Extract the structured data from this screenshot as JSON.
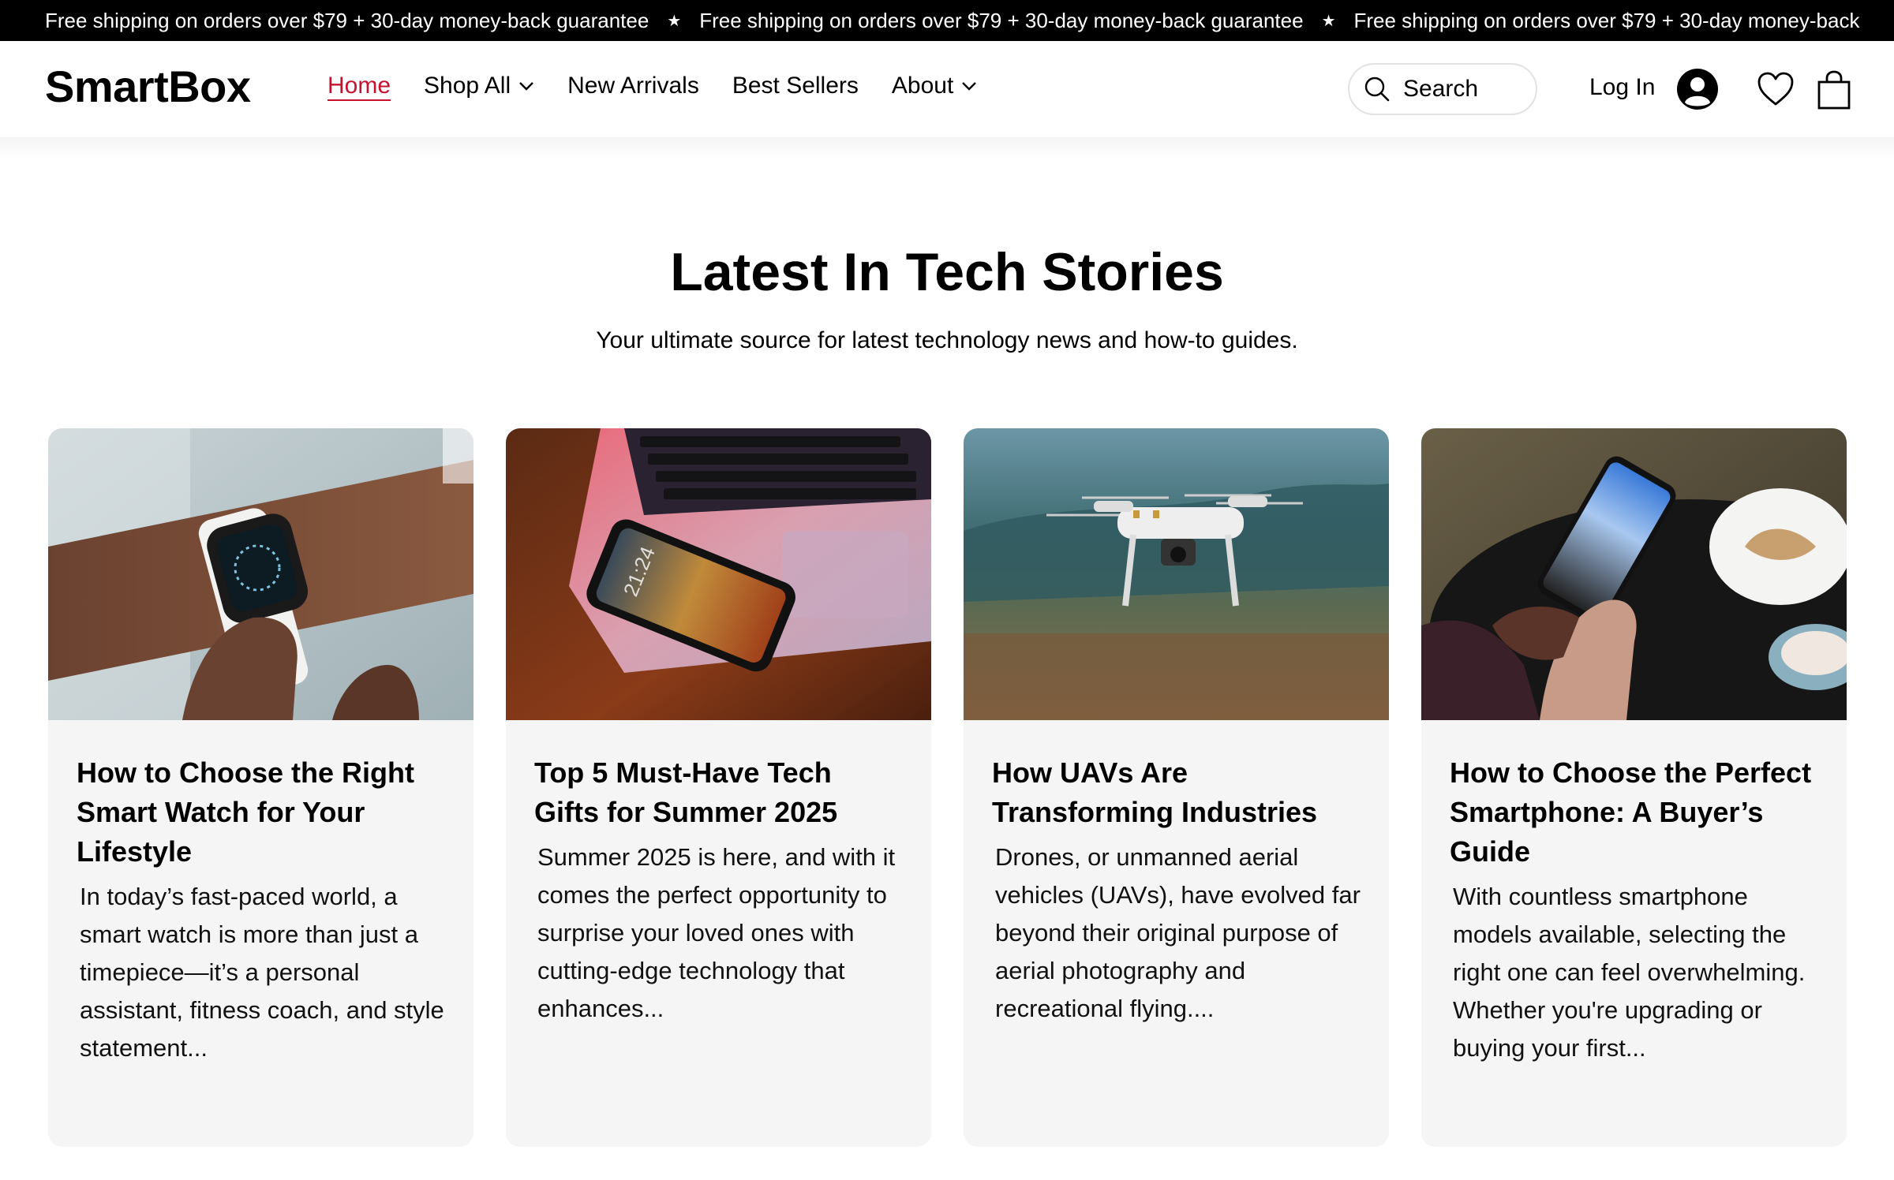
{
  "announcement": {
    "messages": [
      "Free shipping on orders over $79 + 30-day money-back guarantee",
      "Free shipping on orders over $79 + 30-day money-back guarantee",
      "Free shipping on orders over $79 + 30-day money-back"
    ],
    "separator": "★"
  },
  "header": {
    "logo": "SmartBox",
    "nav": [
      {
        "label": "Home",
        "active": true,
        "has_dropdown": false
      },
      {
        "label": "Shop All",
        "active": false,
        "has_dropdown": true
      },
      {
        "label": "New Arrivals",
        "active": false,
        "has_dropdown": false
      },
      {
        "label": "Best Sellers",
        "active": false,
        "has_dropdown": false
      },
      {
        "label": "About",
        "active": false,
        "has_dropdown": true
      }
    ],
    "search": {
      "placeholder": "Search",
      "icon": "search-icon"
    },
    "login_label": "Log In",
    "icons": [
      "avatar-icon",
      "heart-icon",
      "shopping-bag-icon"
    ],
    "active_color": "#c8102e"
  },
  "blog": {
    "title": "Latest In Tech Stories",
    "subtitle": "Your ultimate source for latest technology news and how-to guides.",
    "posts": [
      {
        "title": "How to Choose the Right Smart Watch for Your Lifestyle",
        "excerpt": "In today’s fast-paced world, a smart watch is more than just a timepiece—it’s a personal assistant, fitness coach, and style statement...",
        "image": "smart-watch-on-wrist-photo"
      },
      {
        "title": "Top 5 Must-Have Tech Gifts for Summer 2025",
        "excerpt": "Summer 2025 is here, and with it comes the perfect opportunity to surprise your loved ones with cutting-edge technology that enhances...",
        "image": "smartphone-on-laptop-photo",
        "phone_clock": "21:24"
      },
      {
        "title": "How UAVs Are Transforming Industries",
        "excerpt": "Drones, or unmanned aerial vehicles (UAVs), have evolved far beyond their original purpose of aerial photography and recreational flying....",
        "image": "flying-drone-photo"
      },
      {
        "title": "How to Choose the Perfect Smartphone: A Buyer’s Guide",
        "excerpt": "With countless smartphone models available, selecting the right one can feel overwhelming. Whether you're upgrading or buying your first...",
        "image": "hand-holding-smartphone-photo"
      }
    ]
  }
}
